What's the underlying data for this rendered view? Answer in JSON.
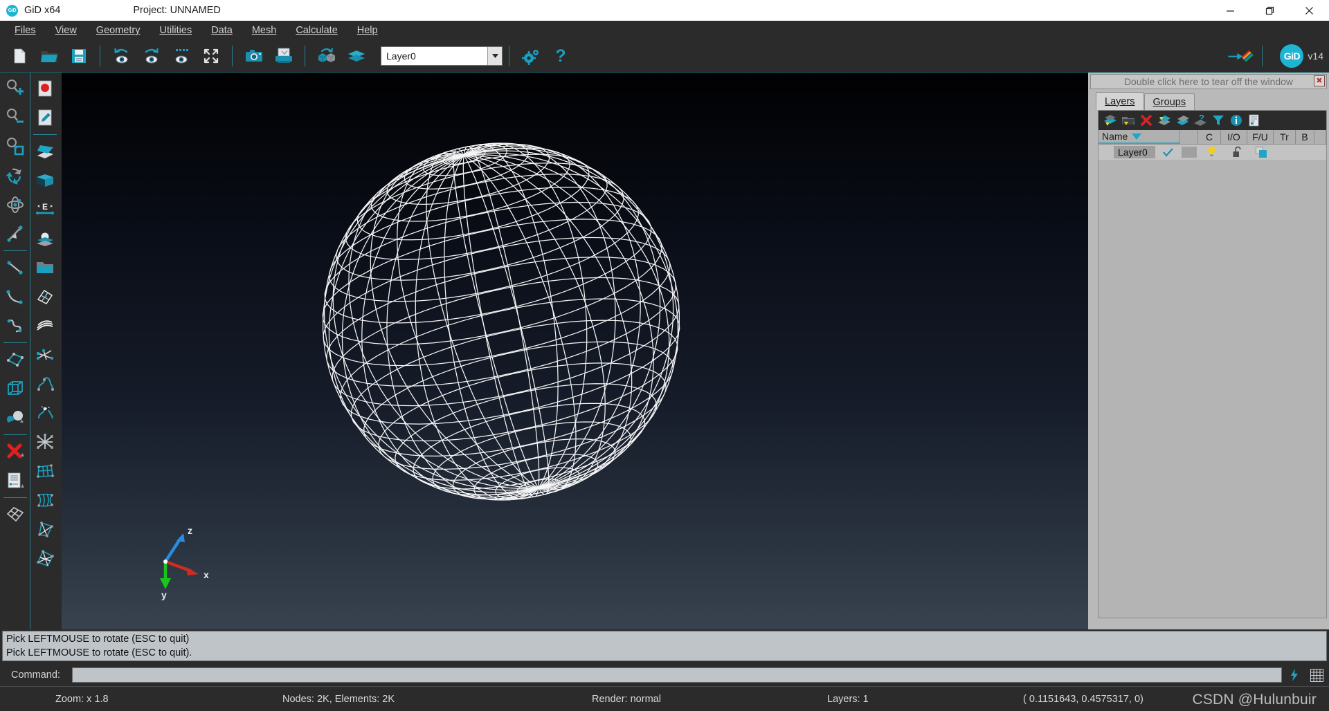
{
  "titlebar": {
    "logo_text": "GiD",
    "app_title": "GiD x64",
    "project_label": "Project: UNNAMED",
    "minimize_icon": "minimize-icon",
    "maximize_icon": "maximize-icon",
    "close_icon": "close-icon"
  },
  "menubar": {
    "items": [
      {
        "label": "Files",
        "accel": "F"
      },
      {
        "label": "View",
        "accel": "V"
      },
      {
        "label": "Geometry",
        "accel": "G"
      },
      {
        "label": "Utilities",
        "accel": "U"
      },
      {
        "label": "Data",
        "accel": "D"
      },
      {
        "label": "Mesh",
        "accel": "M"
      },
      {
        "label": "Calculate",
        "accel": "C"
      },
      {
        "label": "Help",
        "accel": "H"
      }
    ]
  },
  "toolbar": {
    "icons": [
      "new-file-icon",
      "open-folder-icon",
      "save-icon",
      "undo-view-icon",
      "redo-view-icon",
      "zoom-frame-icon",
      "zoom-fit-icon",
      "screenshot-camera-icon",
      "print-icon",
      "rotate-objects-icon",
      "layers-icon"
    ],
    "layer_combo_value": "Layer0",
    "layer_combo_arrow_icon": "chevron-down-icon",
    "settings_icon": "gear-icon",
    "help_icon": "question-mark-icon",
    "render-arrow-icon": "render-arrow-icon",
    "gid_badge_text": "GiD",
    "version_label": "v14"
  },
  "left_toolbar": {
    "column1": [
      "zoom-in-icon",
      "zoom-out-icon",
      "zoom-window-icon",
      "rotate-trackball-icon",
      "rotate-object-icon",
      "pan-icon",
      "separator",
      "line-icon",
      "arc-icon",
      "nurbs-curve-icon",
      "separator",
      "surface-quad-icon",
      "volume-cube-icon",
      "object-primitives-icon",
      "separator",
      "delete-x-icon",
      "list-entities-icon",
      "separator",
      "mesh-quad-icon"
    ],
    "column2": [
      "record-red-icon",
      "edit-pencil-icon",
      "separator",
      "layers-open-icon",
      "volume-box-icon",
      "element-scale-icon",
      "object-on-plane-icon",
      "open-folder-teal-icon",
      "mesh-surface-icon",
      "mesh-layers-icon",
      "mesh-lines-icon",
      "curve-mesh-icon",
      "dotted-curve-icon",
      "node-star-icon",
      "structured-mesh-icon",
      "surface-mesh-icon",
      "volume-mesh-icon",
      "mesh-cut-icon"
    ]
  },
  "viewport": {
    "model": "wireframe-sphere-mesh",
    "axis_triad": {
      "x_label": "x",
      "y_label": "y",
      "z_label": "z",
      "x_color": "#d02c21",
      "y_color": "#19c41c",
      "z_color": "#2a8ce0"
    }
  },
  "right_panel": {
    "tearoff_text": "Double click here to tear off the window",
    "tearoff_close_icon": "close-icon",
    "tabs": [
      {
        "label": "Layers",
        "accel": "L",
        "active": true
      },
      {
        "label": "Groups",
        "accel": "G",
        "active": false
      }
    ],
    "panel_toolbar_icons": [
      "new-layer-icon",
      "new-layer-group-icon",
      "delete-layer-icon",
      "send-to-layer-icon",
      "layer-to-use-icon",
      "layer-help-icon",
      "filter-icon",
      "layer-info-icon",
      "layer-report-icon"
    ],
    "columns": [
      {
        "key": "name",
        "label": "Name",
        "sort_icon": "sort-down-icon"
      },
      {
        "key": "swatch",
        "label": ""
      },
      {
        "key": "c",
        "label": "C"
      },
      {
        "key": "io",
        "label": "I/O"
      },
      {
        "key": "fu",
        "label": "F/U"
      },
      {
        "key": "tr",
        "label": "Tr"
      },
      {
        "key": "b",
        "label": "B"
      }
    ],
    "rows": [
      {
        "name": "Layer0",
        "check_icon": "checkmark-icon",
        "color_swatch": "#a0a0a0",
        "io_icon": "lightbulb-on-icon",
        "fu_icon": "unlocked-padlock-icon",
        "tr_icon": "transparency-squares-icon",
        "b_icon": ""
      }
    ]
  },
  "messages": {
    "lines": [
      "Pick LEFTMOUSE to rotate (ESC to quit)",
      "Pick LEFTMOUSE to rotate (ESC to quit)."
    ]
  },
  "command_bar": {
    "label": "Command:",
    "value": "",
    "placeholder": "",
    "quick_icon": "lightning-bolt-icon",
    "grid_icon": "grid-icon"
  },
  "statusbar": {
    "zoom": "Zoom: x 1.8",
    "mesh": "Nodes: 2K, Elements: 2K",
    "render": "Render: normal",
    "layers": "Layers: 1",
    "coords": "( 0.1151643, 0.4575317, 0)"
  },
  "watermark": "CSDN @Hulunbuir",
  "colors": {
    "accent_teal": "#1eb4d4",
    "toolbar_bg": "#2b2b2b",
    "panel_bg": "#b9b9b9",
    "mesh_line": "#ffffff"
  }
}
